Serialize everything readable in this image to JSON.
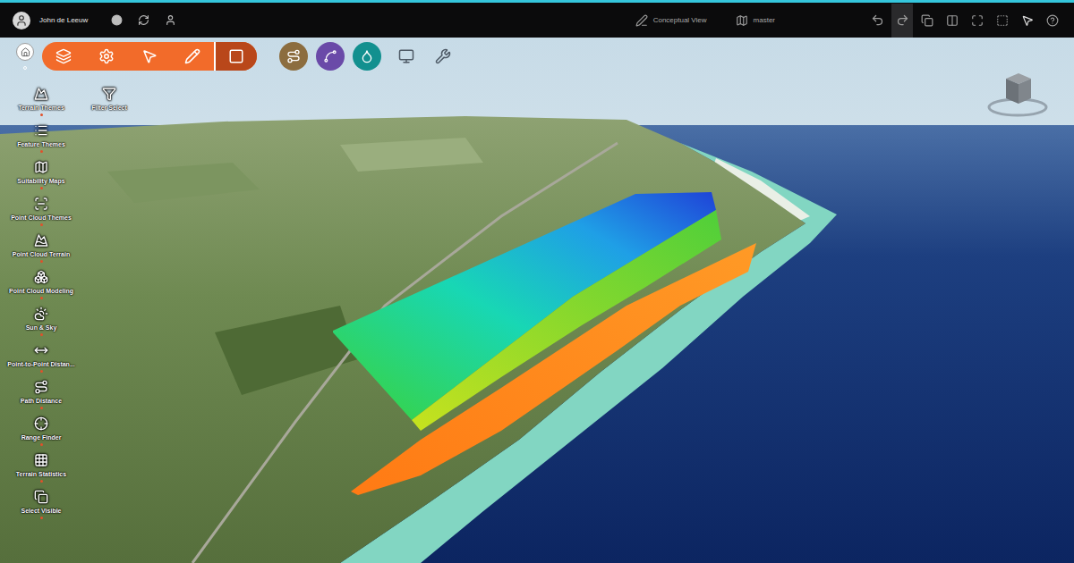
{
  "header": {
    "user": "John de Leeuw",
    "view": "Conceptual View",
    "branch": "master"
  },
  "main_toolbar": [
    {
      "selected": false
    },
    {
      "selected": false
    },
    {
      "selected": false
    },
    {
      "selected": false
    },
    {
      "selected": true
    }
  ],
  "mode_buttons": [
    {
      "color": "#8c6d3f"
    },
    {
      "color": "#6a4aa8"
    },
    {
      "color": "#12908f"
    }
  ],
  "tools": [
    {
      "label": "Terrain Themes"
    },
    {
      "label": "Feature Themes"
    },
    {
      "label": "Suitability Maps"
    },
    {
      "label": "Point Cloud Themes"
    },
    {
      "label": "Point Cloud Terrain"
    },
    {
      "label": "Point Cloud Modeling"
    },
    {
      "label": "Sun & Sky"
    },
    {
      "label": "Point-to-Point Distan..."
    },
    {
      "label": "Path Distance"
    },
    {
      "label": "Range Finder"
    },
    {
      "label": "Terrain Statistics"
    },
    {
      "label": "Select Visible"
    }
  ],
  "filter": {
    "label": "Filter Select"
  }
}
